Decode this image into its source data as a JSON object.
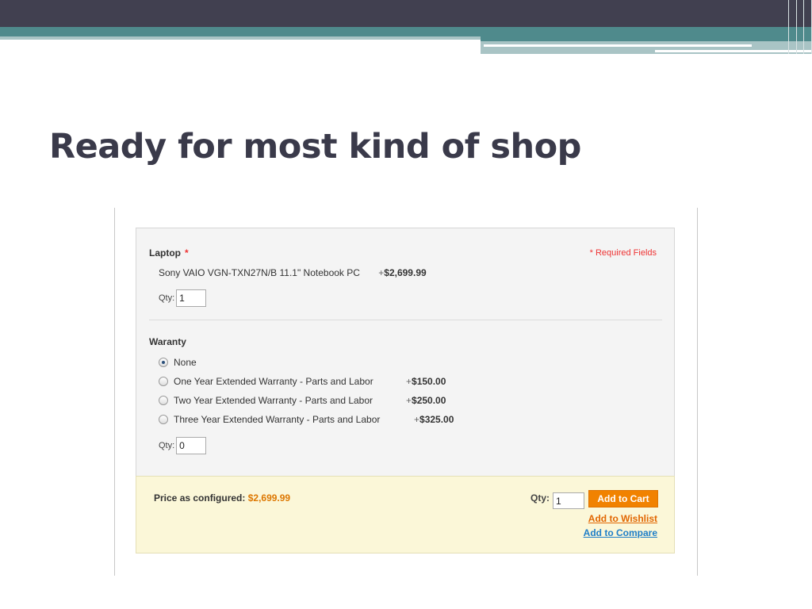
{
  "slide": {
    "title": "Ready for most kind of shop"
  },
  "options": {
    "required_note": "* Required Fields",
    "laptop": {
      "label": "Laptop",
      "required_mark": "*",
      "product_name": "Sony VAIO VGN-TXN27N/B 11.1\" Notebook PC",
      "price_prefix": "+",
      "price": "$2,699.99",
      "qty_label": "Qty:",
      "qty_value": "1"
    },
    "warranty": {
      "label": "Waranty",
      "choices": [
        {
          "label": "None",
          "selected": true
        },
        {
          "label": "One Year Extended Warranty - Parts and Labor",
          "price_prefix": "+",
          "price": "$150.00",
          "selected": false
        },
        {
          "label": "Two Year Extended Warranty - Parts and Labor",
          "price_prefix": "+",
          "price": "$250.00",
          "selected": false
        },
        {
          "label": "Three Year Extended Warranty - Parts and Labor",
          "price_prefix": "+",
          "price": "$325.00",
          "selected": false
        }
      ],
      "qty_label": "Qty:",
      "qty_value": "0"
    }
  },
  "summary": {
    "price_label": "Price as configured:",
    "price_value": "$2,699.99",
    "qty_label": "Qty:",
    "qty_value": "1",
    "add_to_cart": "Add to Cart",
    "add_to_wishlist": "Add to Wishlist",
    "add_to_compare": "Add to Compare"
  },
  "colors": {
    "header_dark": "#414050",
    "header_teal": "#4f8a8c",
    "price_accent": "#dd7700",
    "cart_button": "#f18200",
    "required_red": "#e33333",
    "compare_link": "#1e7ec8"
  }
}
